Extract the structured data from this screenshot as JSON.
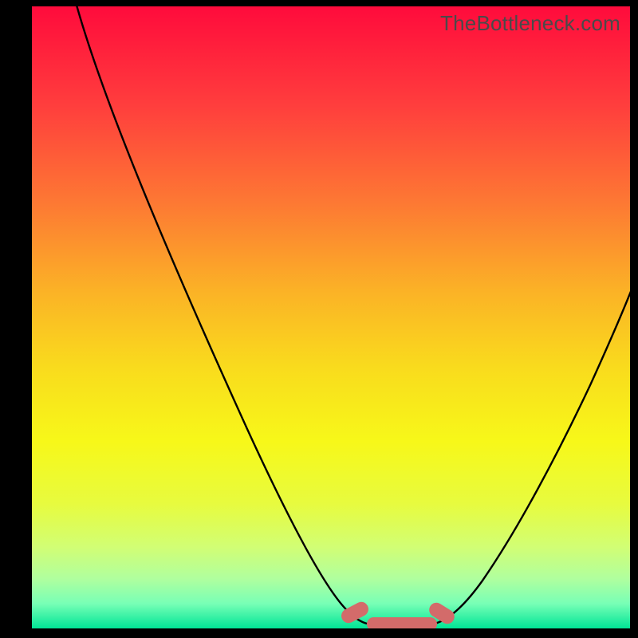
{
  "watermark": "TheBottleneck.com",
  "chart_data": {
    "type": "line",
    "title": "",
    "xlabel": "",
    "ylabel": "",
    "xlim": [
      0,
      100
    ],
    "ylim": [
      0,
      100
    ],
    "gradient_stops": [
      {
        "offset": 0,
        "color": "#ff0b3c"
      },
      {
        "offset": 20,
        "color": "#ff4f3b"
      },
      {
        "offset": 40,
        "color": "#fc9b2b"
      },
      {
        "offset": 55,
        "color": "#f9d21e"
      },
      {
        "offset": 70,
        "color": "#f7f71a"
      },
      {
        "offset": 80,
        "color": "#e2fb4a"
      },
      {
        "offset": 88,
        "color": "#c9ff7d"
      },
      {
        "offset": 94,
        "color": "#9cffb0"
      },
      {
        "offset": 98,
        "color": "#4dffb9"
      },
      {
        "offset": 100,
        "color": "#00e596"
      }
    ],
    "curve": {
      "description": "Asymmetric V-shaped bottleneck curve. Steep left descent reaching ~0 around x≈55–65, then rising again toward the right edge reaching ~55 at x=100.",
      "points_xy": [
        [
          7,
          100
        ],
        [
          15,
          82
        ],
        [
          25,
          62
        ],
        [
          35,
          42
        ],
        [
          45,
          22
        ],
        [
          51,
          8
        ],
        [
          55,
          1
        ],
        [
          60,
          0
        ],
        [
          65,
          0
        ],
        [
          68,
          1
        ],
        [
          72,
          5
        ],
        [
          78,
          14
        ],
        [
          85,
          27
        ],
        [
          92,
          41
        ],
        [
          100,
          55
        ]
      ]
    },
    "highlight_segments": [
      {
        "x_start": 53,
        "x_end": 55,
        "axis_y": 0,
        "note": "left tip of flat minimum"
      },
      {
        "x_start": 56,
        "x_end": 66,
        "axis_y": 0,
        "note": "flat minimum band"
      },
      {
        "x_start": 67,
        "x_end": 69,
        "axis_y": 0,
        "note": "right tip of flat minimum"
      }
    ]
  }
}
